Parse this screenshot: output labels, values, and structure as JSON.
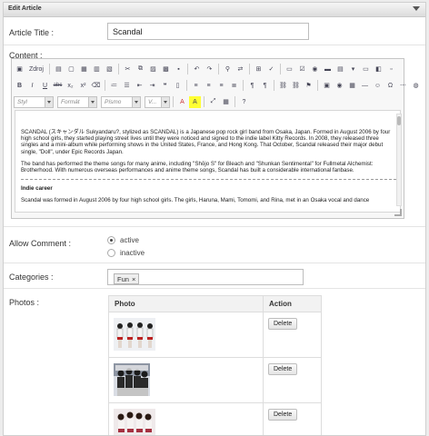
{
  "panel": {
    "title": "Edit Article"
  },
  "article_title": {
    "label": "Article Title :",
    "value": "Scandal"
  },
  "content": {
    "label": "Content :",
    "toolbar": {
      "source_label": "Zdroj",
      "style_combo": "Styl",
      "format_combo": "Formát",
      "font_combo": "Písmo",
      "size_combo": "V...",
      "bold": "B",
      "italic": "I",
      "underline": "U",
      "strike": "abc",
      "subscript": "x₂",
      "superscript": "x²"
    },
    "paragraphs": [
      "SCANDAL (スキャンダル Sukyandaru?, stylized as SCANDAL) is a Japanese pop rock girl band from Osaka, Japan. Formed in August 2006 by four high school girls, they started playing street lives until they were noticed and signed to the indie label Kitty Records. In 2008, they released three singles and a mini-album while performing shows in the United States, France, and Hong Kong. That October, Scandal released their major debut single, \"Doll\", under Epic Records Japan.",
      "The band has performed the theme songs for many anime, including \"Shōjo S\" for Bleach and \"Shunkan Sentimental\" for Fullmetal Alchemist: Brotherhood. With numerous overseas performances and anime theme songs, Scandal has built a considerable international fanbase."
    ],
    "heading": "Indie career",
    "tail_paragraph": "Scandal was formed in August 2006 by four high school girls. The girls, Haruna, Mami, Tomomi, and Rina, met in an Osaka vocal and dance"
  },
  "allow_comment": {
    "label": "Allow Comment :",
    "options": [
      {
        "label": "active",
        "selected": true
      },
      {
        "label": "inactive",
        "selected": false
      }
    ]
  },
  "categories": {
    "label": "Categories :",
    "tags": [
      "Fun"
    ],
    "remove_glyph": "×"
  },
  "photos": {
    "label": "Photos :",
    "col_photo": "Photo",
    "col_action": "Action",
    "rows": [
      {
        "action": "Delete"
      },
      {
        "action": "Delete"
      },
      {
        "action": "Delete"
      }
    ]
  },
  "colors": {
    "panel_header_bg": "#dcdcdc",
    "border": "#cfcfcf",
    "text": "#333333"
  }
}
